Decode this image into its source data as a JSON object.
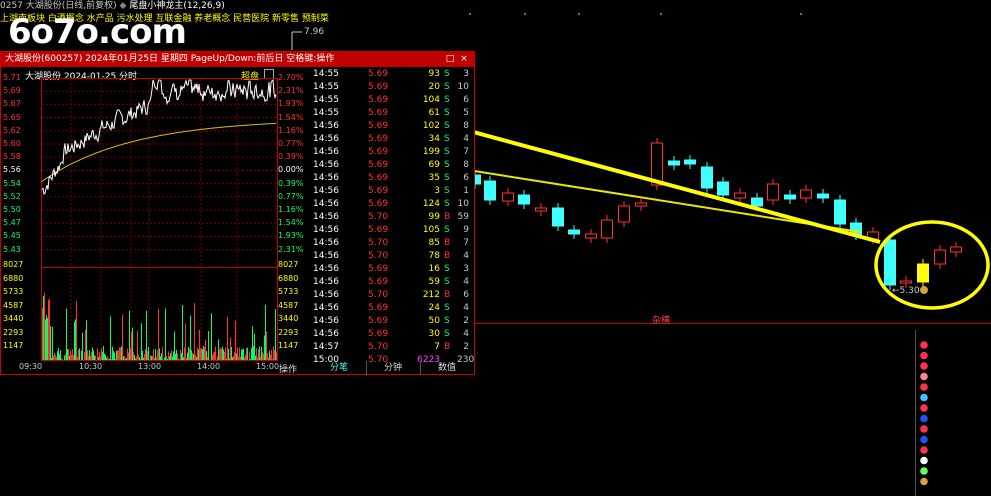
{
  "header": {
    "stock_line": "0257 大湖股份(日线,前复权)",
    "indicator_name": "尾盘小神龙主(12,26,9)",
    "concepts": "上湖南板块 白酒概念 水产品 污水处理 互联金融 养老概念 民营医院 新零售 预制菜",
    "high_price_label": "7.96",
    "low_price_label": "5.30",
    "watermark": "6o7o.com"
  },
  "popup": {
    "title": "大湖股份(600257)  2024年01月25日  星期四  PageUp/Down:前后日  空格键:操作",
    "close_glyph": "×",
    "restore_glyph": "□",
    "subtitle": "大湖股份  2024-01-25 分时",
    "super_button": "超盘",
    "price_ticks": [
      "5.71",
      "5.69",
      "5.67",
      "5.65",
      "5.62",
      "5.60",
      "5.58",
      "5.56",
      "5.54",
      "5.52",
      "5.50",
      "5.47",
      "5.45",
      "5.43"
    ],
    "pct_ticks": [
      "2.70%",
      "2.31%",
      "1.93%",
      "1.54%",
      "1.16%",
      "0.77%",
      "0.39%",
      "0.00%",
      "0.39%",
      "0.77%",
      "1.16%",
      "1.54%",
      "1.93%",
      "2.31%"
    ],
    "vol_ticks_left": [
      "8027",
      "6880",
      "5733",
      "4587",
      "3440",
      "2293",
      "1147"
    ],
    "vol_ticks_right": [
      "8027",
      "6880",
      "5733",
      "4587",
      "3440",
      "2293",
      "1147"
    ],
    "time_ticks": [
      "09:30",
      "10:30",
      "13:00",
      "14:00",
      "15:00"
    ],
    "operation_label": "操作",
    "tabs": [
      "分笔",
      "分钟",
      "数值"
    ]
  },
  "ticks": [
    {
      "time": "14:55",
      "price": "5.69",
      "vol": "93",
      "dir": "S",
      "n": "3"
    },
    {
      "time": "14:55",
      "price": "5.69",
      "vol": "20",
      "dir": "S",
      "n": "10"
    },
    {
      "time": "14:55",
      "price": "5.69",
      "vol": "104",
      "dir": "S",
      "n": "6"
    },
    {
      "time": "14:55",
      "price": "5.69",
      "vol": "61",
      "dir": "S",
      "n": "5"
    },
    {
      "time": "14:56",
      "price": "5.69",
      "vol": "102",
      "dir": "S",
      "n": "8"
    },
    {
      "time": "14:56",
      "price": "5.69",
      "vol": "34",
      "dir": "S",
      "n": "4"
    },
    {
      "time": "14:56",
      "price": "5.69",
      "vol": "199",
      "dir": "S",
      "n": "7"
    },
    {
      "time": "14:56",
      "price": "5.69",
      "vol": "69",
      "dir": "S",
      "n": "8"
    },
    {
      "time": "14:56",
      "price": "5.69",
      "vol": "35",
      "dir": "S",
      "n": "6"
    },
    {
      "time": "14:56",
      "price": "5.69",
      "vol": "3",
      "dir": "S",
      "n": "1"
    },
    {
      "time": "14:56",
      "price": "5.69",
      "vol": "124",
      "dir": "S",
      "n": "10"
    },
    {
      "time": "14:56",
      "price": "5.70",
      "vol": "99",
      "dir": "B",
      "n": "59"
    },
    {
      "time": "14:56",
      "price": "5.69",
      "vol": "105",
      "dir": "S",
      "n": "9"
    },
    {
      "time": "14:56",
      "price": "5.70",
      "vol": "85",
      "dir": "B",
      "n": "7"
    },
    {
      "time": "14:56",
      "price": "5.70",
      "vol": "78",
      "dir": "B",
      "n": "4"
    },
    {
      "time": "14:56",
      "price": "5.69",
      "vol": "16",
      "dir": "S",
      "n": "3"
    },
    {
      "time": "14:56",
      "price": "5.69",
      "vol": "59",
      "dir": "S",
      "n": "4"
    },
    {
      "time": "14:56",
      "price": "5.70",
      "vol": "212",
      "dir": "B",
      "n": "6"
    },
    {
      "time": "14:56",
      "price": "5.69",
      "vol": "24",
      "dir": "S",
      "n": "4"
    },
    {
      "time": "14:56",
      "price": "5.69",
      "vol": "50",
      "dir": "S",
      "n": "2"
    },
    {
      "time": "14:56",
      "price": "5.69",
      "vol": "30",
      "dir": "S",
      "n": "4"
    },
    {
      "time": "14:57",
      "price": "5.70",
      "vol": "7",
      "dir": "B",
      "n": "2"
    },
    {
      "time": "15:00",
      "price": "5.70",
      "vol": "6223",
      "dir": "",
      "n": "230"
    }
  ],
  "main_chart": {
    "label_za": "杂横"
  },
  "colors": {
    "up": "#ff3030",
    "down": "#40ffff",
    "flat": "#ffffff",
    "highlight": "#ffff00",
    "frame": "#c00000"
  }
}
